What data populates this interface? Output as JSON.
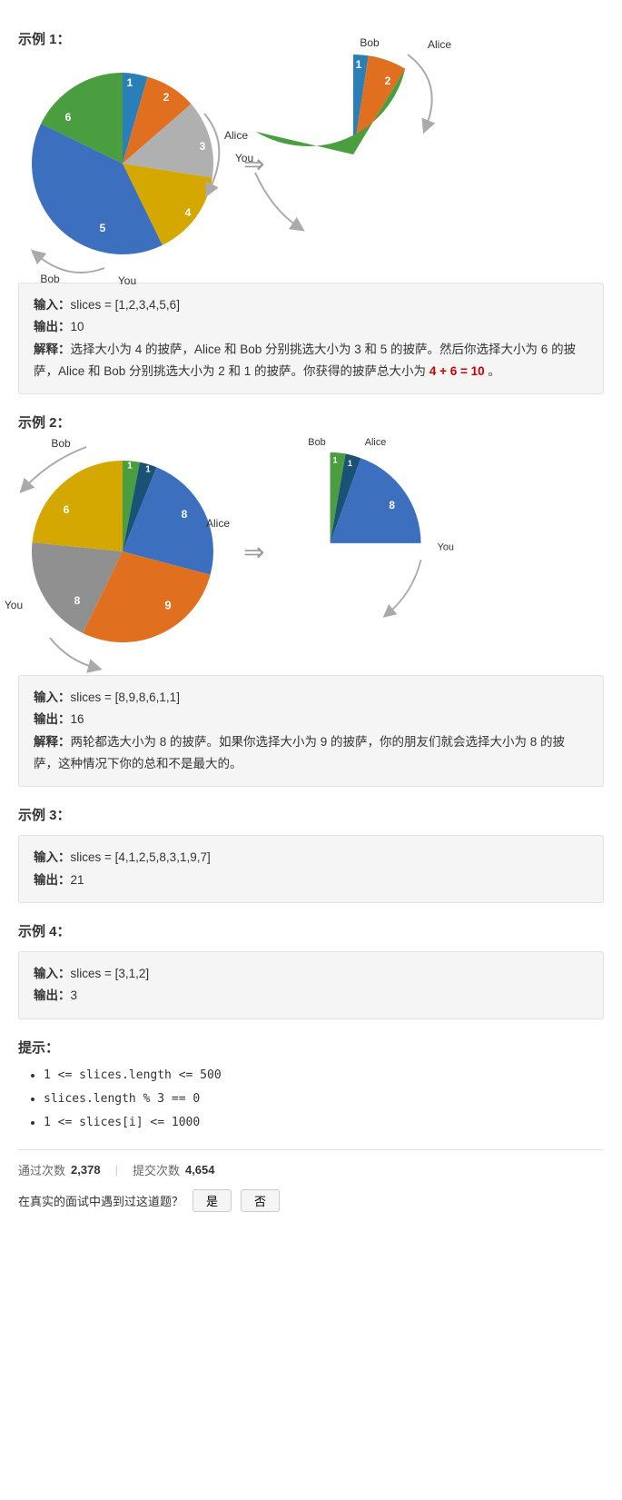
{
  "examples": [
    {
      "id": "示例 1：",
      "input_label": "输入：",
      "input_value": "slices = [1,2,3,4,5,6]",
      "output_label": "输出：",
      "output_value": "10",
      "explain_label": "解释：",
      "explain_text": "选择大小为 4 的披萨，Alice 和 Bob 分别挑选大小为 3 和 5 的披萨。然后你选择大小为 6 的披萨，Alice 和 Bob 分别挑选大小为 2 和 1 的披萨。你获得的披萨总大小为 ",
      "explain_formula": "4 + 6 = 10",
      "explain_end": " 。"
    },
    {
      "id": "示例 2：",
      "input_label": "输入：",
      "input_value": "slices = [8,9,8,6,1,1]",
      "output_label": "输出：",
      "output_value": "16",
      "explain_label": "解释：",
      "explain_text": "两轮都选大小为 8 的披萨。如果你选择大小为 9 的披萨，你的朋友们就会选择大小为 8 的披萨，这种情况下你的总和不是最大的。",
      "explain_formula": null,
      "explain_end": null
    },
    {
      "id": "示例 3：",
      "input_label": "输入：",
      "input_value": "slices = [4,1,2,5,8,3,1,9,7]",
      "output_label": "输出：",
      "output_value": "21",
      "explain_label": null,
      "explain_text": null
    },
    {
      "id": "示例 4：",
      "input_label": "输入：",
      "input_value": "slices = [3,1,2]",
      "output_label": "输出：",
      "output_value": "3",
      "explain_label": null,
      "explain_text": null
    }
  ],
  "hints": {
    "title": "提示：",
    "items": [
      "1 <= slices.length <= 500",
      "slices.length % 3 == 0",
      "1 <= slices[i] <= 1000"
    ]
  },
  "stats": {
    "pass_label": "通过次数",
    "pass_value": "2,378",
    "submit_label": "提交次数",
    "submit_value": "4,654"
  },
  "interview": {
    "question": "在真实的面试中遇到过这道题？",
    "yes": "是",
    "no": "否"
  }
}
